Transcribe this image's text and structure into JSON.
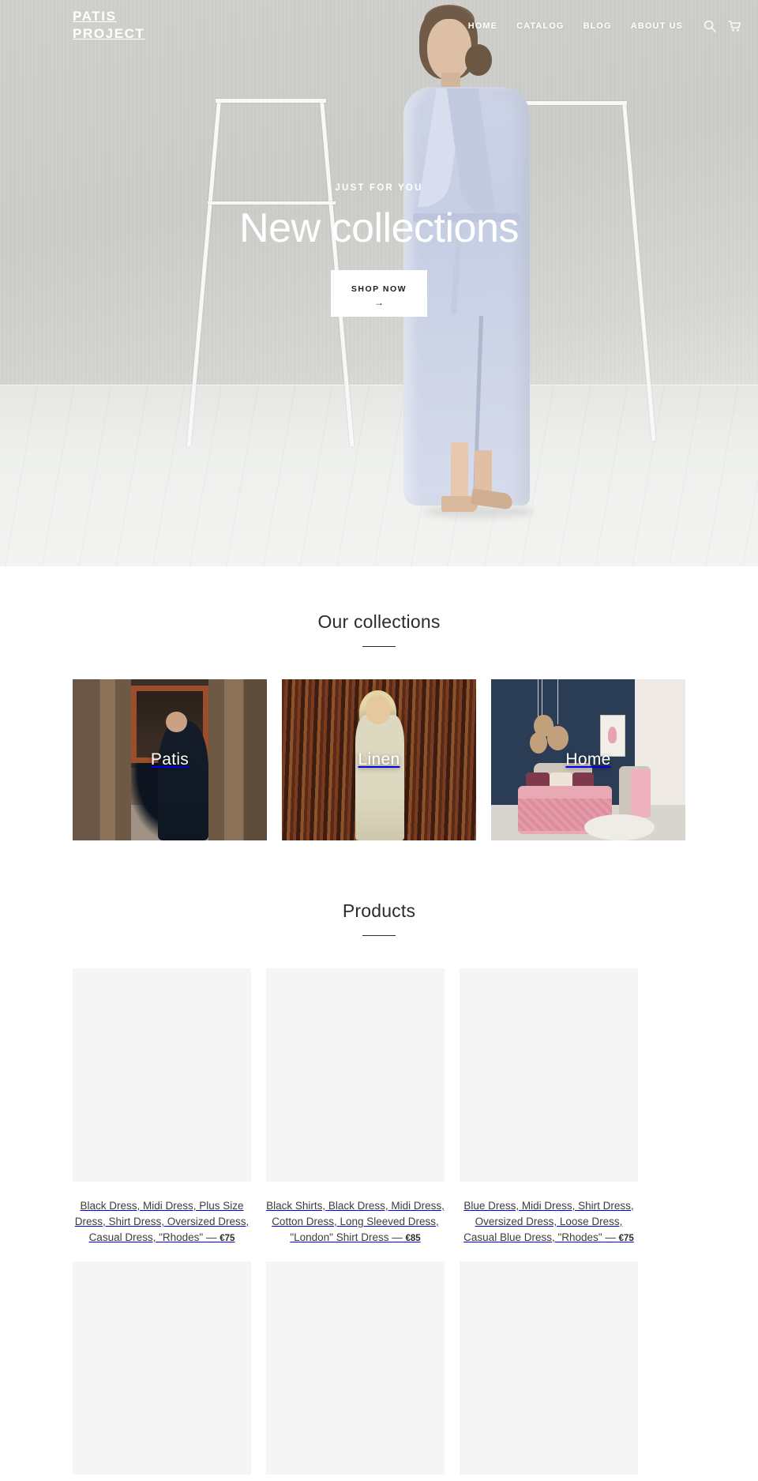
{
  "header": {
    "logo_line1": "PATIS",
    "logo_line2": "PROJECT",
    "nav": [
      {
        "label": "HOME",
        "name": "nav-home"
      },
      {
        "label": "CATALOG",
        "name": "nav-catalog"
      },
      {
        "label": "BLOG",
        "name": "nav-blog"
      },
      {
        "label": "ABOUT US",
        "name": "nav-about-us"
      }
    ],
    "icons": [
      {
        "name": "search-icon",
        "label": "Search"
      },
      {
        "name": "cart-icon",
        "label": "Cart"
      }
    ]
  },
  "hero": {
    "eyebrow": "JUST FOR YOU",
    "title": "New collections",
    "cta_label": "SHOP NOW",
    "cta_arrow": "→",
    "background_color": "#c9cac6"
  },
  "collections": {
    "title": "Our collections",
    "items": [
      {
        "label": "Patis"
      },
      {
        "label": "Linen"
      },
      {
        "label": "Home"
      }
    ]
  },
  "products": {
    "title": "Products",
    "currency": "€",
    "separator": "—",
    "items": [
      {
        "title": "Black Dress, Midi Dress, Plus Size Dress, Shirt Dress, Oversized Dress, Casual Dress, \"Rhodes\"",
        "price": "€75"
      },
      {
        "title": "Black Shirts, Black Dress, Midi Dress, Cotton Dress, Long Sleeved Dress, \"London\" Shirt Dress",
        "price": "€85"
      },
      {
        "title": "Blue Dress, Midi Dress, Shirt Dress, Oversized Dress, Loose Dress, Casual Blue Dress, \"Rhodes\"",
        "price": "€75"
      },
      {
        "title": "",
        "price": ""
      },
      {
        "title": "",
        "price": ""
      },
      {
        "title": "",
        "price": ""
      }
    ]
  },
  "colors": {
    "text": "#3d3d3d",
    "heading": "#2b2b2b",
    "placeholder": "#f5f5f5",
    "hero_overlay_text": "#ffffff"
  }
}
